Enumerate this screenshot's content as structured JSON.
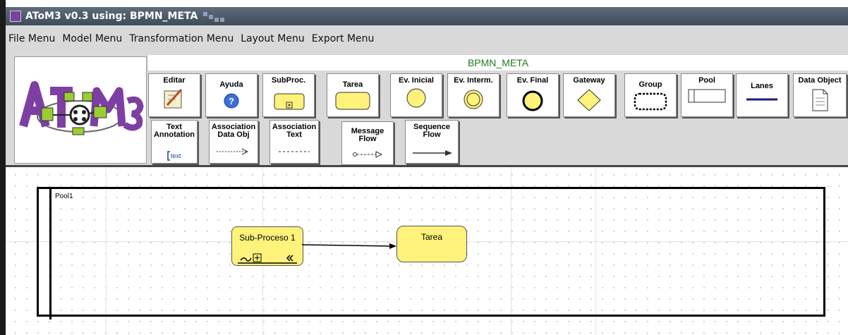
{
  "window": {
    "title": "AToM3 v0.3 using: BPMN_META"
  },
  "menubar": {
    "items": [
      "File Menu",
      "Model Menu",
      "Transformation Menu",
      "Layout Menu",
      "Export Menu"
    ]
  },
  "toolbar": {
    "meta_title": "BPMN_META",
    "buttons": [
      {
        "label": "Editar",
        "icon": "edit-icon"
      },
      {
        "label": "Ayuda",
        "icon": "help-icon"
      },
      {
        "label": "SubProc.",
        "icon": "subprocess-icon"
      },
      {
        "label": "Tarea",
        "icon": "task-icon"
      },
      {
        "label": "Ev. Inicial",
        "icon": "start-event-icon"
      },
      {
        "label": "Ev. Interm.",
        "icon": "intermediate-event-icon"
      },
      {
        "label": "Ev. Final",
        "icon": "end-event-icon"
      },
      {
        "label": "Gateway",
        "icon": "gateway-icon"
      },
      {
        "label": "Group",
        "icon": "group-icon"
      },
      {
        "label": "Pool",
        "icon": "pool-icon"
      },
      {
        "label": "Lanes",
        "icon": "lanes-icon"
      },
      {
        "label": "Data Object",
        "icon": "data-object-icon"
      },
      {
        "label": "Text Annotation",
        "icon": "text-annotation-icon",
        "icon_text": "text"
      },
      {
        "label": "Association Data Obj",
        "icon": "association-dataobj-icon"
      },
      {
        "label": "Association Text",
        "icon": "association-text-icon"
      },
      {
        "label": "Message Flow",
        "icon": "message-flow-icon"
      },
      {
        "label": "Sequence Flow",
        "icon": "sequence-flow-icon"
      }
    ]
  },
  "colors": {
    "task_fill": "#fff27a",
    "gateway_fill": "#fff27a",
    "meta_title": "#1f7a1f",
    "logo_purple": "#7d3fa3",
    "logo_green": "#9acd32"
  },
  "canvas": {
    "pool": {
      "label": "Pool1"
    },
    "subprocess": {
      "label": "Sub-Proceso 1"
    },
    "task": {
      "label": "Tarea"
    }
  }
}
